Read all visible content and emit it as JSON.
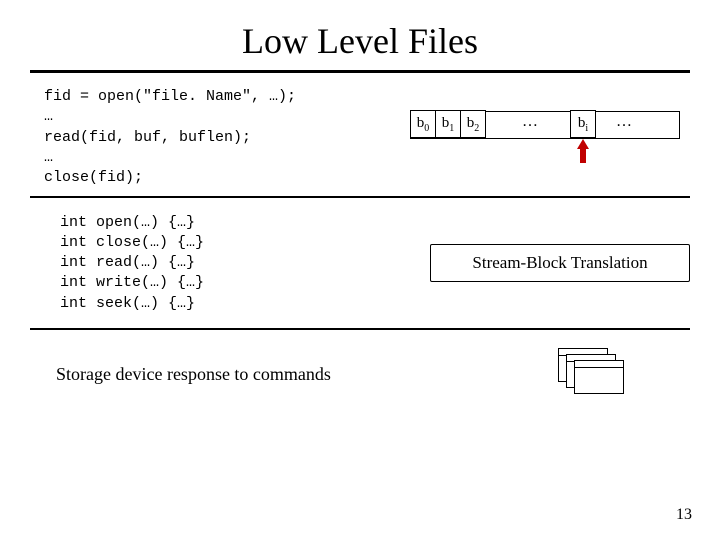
{
  "title": "Low Level Files",
  "api_code": "fid = open(\"file. Name\", …);\n…\nread(fid, buf, buflen);\n…\nclose(fid);",
  "blocks": {
    "b0": "b",
    "b0_sub": "0",
    "b1": "b",
    "b1_sub": "1",
    "b2": "b",
    "b2_sub": "2",
    "mid_ellipsis": "…",
    "bi": "b",
    "bi_sub": "i",
    "tail_ellipsis": "…"
  },
  "impl_code": "int open(…) {…}\nint close(…) {…}\nint read(…) {…}\nint write(…) {…}\nint seek(…) {…}",
  "sbt_label": "Stream-Block Translation",
  "storage_caption": "Storage device response to commands",
  "page_number": "13"
}
